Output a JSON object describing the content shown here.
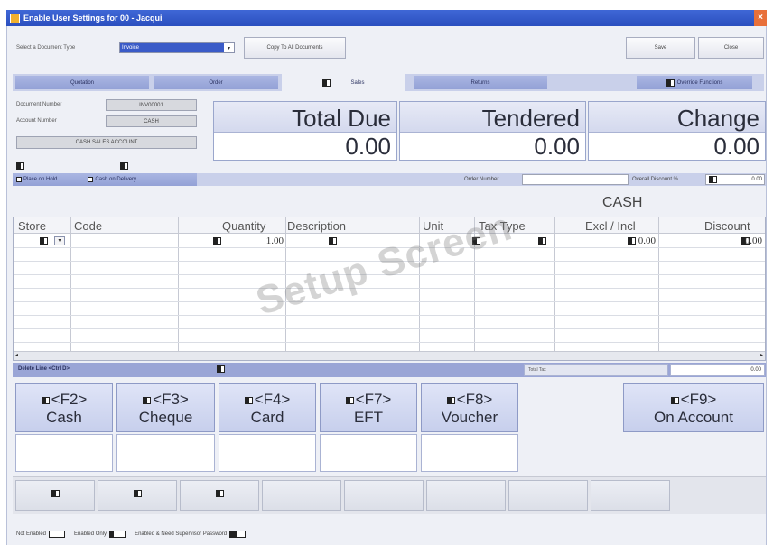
{
  "window": {
    "title": "Enable User Settings for 00 - Jacqui",
    "close_label": "×"
  },
  "toolbar": {
    "doc_type_label": "Select a Document Type",
    "doc_type_value": "Invoice",
    "copy_label": "Copy To All Documents",
    "save_label": "Save",
    "close_label": "Close"
  },
  "tabs": [
    "Quotation",
    "Order",
    "Sales",
    "Returns"
  ],
  "override_label": "Override Functions",
  "document": {
    "number_label": "Document Number",
    "number_value": "INV00001",
    "account_label": "Account Number",
    "account_value": "CASH",
    "account_name": "CASH SALES ACCOUNT"
  },
  "totals": [
    {
      "label": "Total Due",
      "value": "0.00"
    },
    {
      "label": "Tendered",
      "value": "0.00"
    },
    {
      "label": "Change",
      "value": "0.00"
    }
  ],
  "options": {
    "place_on_hold": "Place on Hold",
    "cash_on_delivery": "Cash on Delivery",
    "order_number_label": "Order Number",
    "overall_discount_label": "Overall Discount %",
    "overall_discount_value": "0.00"
  },
  "customer_label": "CASH",
  "grid": {
    "columns": [
      "Store",
      "Code",
      "Quantity",
      "Description",
      "Unit",
      "Tax Type",
      "Excl / Incl",
      "Discount"
    ],
    "row": {
      "quantity": "1.00",
      "excl_incl": "0.00",
      "discount": "0.00"
    }
  },
  "watermark": "Setup Screen",
  "line_bar": {
    "delete_label": "Delete Line <Ctrl D>",
    "total_tax_label": "Total Tax",
    "total_tax_value": "0.00"
  },
  "fkeys": [
    {
      "key": "<F2>",
      "label": "Cash"
    },
    {
      "key": "<F3>",
      "label": "Cheque"
    },
    {
      "key": "<F4>",
      "label": "Card"
    },
    {
      "key": "<F7>",
      "label": "EFT"
    },
    {
      "key": "<F8>",
      "label": "Voucher"
    },
    {
      "key": "<F9>",
      "label": "On Account"
    }
  ],
  "legend": {
    "not_enabled": "Not Enabled",
    "enabled_only": "Enabled Only",
    "enabled_password": "Enabled & Need Supervisor Password"
  }
}
